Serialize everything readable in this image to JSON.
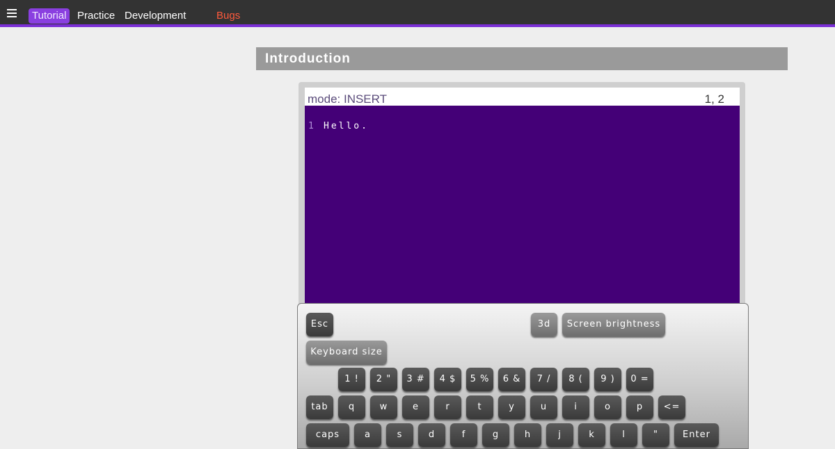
{
  "nav": {
    "items": [
      {
        "label": "Tutorial"
      },
      {
        "label": "Practice"
      },
      {
        "label": "Development"
      },
      {
        "label": "Bugs"
      }
    ]
  },
  "section": {
    "title": "Introduction"
  },
  "editor": {
    "mode": "mode: INSERT",
    "cursor": "1, 2",
    "lines": [
      {
        "number": "1",
        "text": "Hello."
      }
    ]
  },
  "keyboard": {
    "esc": "Esc",
    "three_d": "3d",
    "brightness": "Screen brightness",
    "size": "Keyboard size",
    "number_row": [
      "1 !",
      "2 \"",
      "3 #",
      "4 $",
      "5 %",
      "6 &",
      "7 /",
      "8 (",
      "9 )",
      "0 ="
    ],
    "tab": "tab",
    "top_row": [
      "q",
      "w",
      "e",
      "r",
      "t",
      "y",
      "u",
      "i",
      "o",
      "p"
    ],
    "backspace": "<=",
    "caps": "caps",
    "home_row": [
      "a",
      "s",
      "d",
      "f",
      "g",
      "h",
      "j",
      "k",
      "l",
      "\""
    ],
    "enter": "Enter"
  },
  "colors": {
    "accent": "#7b2fd6",
    "bugs": "#ff5a3c",
    "editor_bg": "#440077"
  }
}
